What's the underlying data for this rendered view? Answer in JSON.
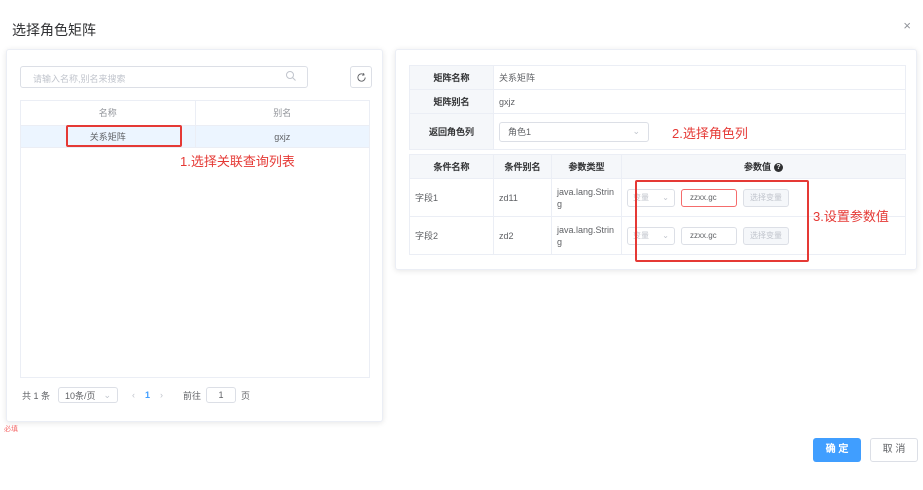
{
  "dialog": {
    "title": "选择角色矩阵",
    "close_icon": "×"
  },
  "left": {
    "search_placeholder": "请输入名称,别名来搜索",
    "table": {
      "headers": [
        "名称",
        "别名"
      ],
      "rows": [
        {
          "name": "关系矩阵",
          "alias": "gxjz"
        }
      ]
    },
    "pagination": {
      "total": "共 1 条",
      "page_size": "10条/页",
      "prev": "‹",
      "current": "1",
      "next": "›",
      "goto": "前往",
      "jump_value": "1",
      "page_suffix": "页"
    },
    "required_note": "必填"
  },
  "right": {
    "info": {
      "matrix_name_label": "矩阵名称",
      "matrix_name_value": "关系矩阵",
      "matrix_alias_label": "矩阵别名",
      "matrix_alias_value": "gxjz",
      "return_col_label": "返回角色列",
      "return_col_value": "角色1"
    },
    "cond_table": {
      "headers": [
        "条件名称",
        "条件别名",
        "参数类型",
        "参数值"
      ],
      "help_icon": "?",
      "rows": [
        {
          "name": "字段1",
          "alias": "zd11",
          "type": "java.lang.String",
          "var_select": "变量",
          "value": "zzxx.gc",
          "choose": "选择变量"
        },
        {
          "name": "字段2",
          "alias": "zd2",
          "type": "java.lang.String",
          "var_select": "变量",
          "value": "zzxx.gc",
          "choose": "选择变量"
        }
      ]
    }
  },
  "annotations": {
    "step1": "1.选择关联查询列表",
    "step2": "2.选择角色列",
    "step3": "3.设置参数值",
    "color": "#e53935"
  },
  "footer": {
    "ok": "确 定",
    "cancel": "取 消"
  },
  "colors": {
    "primary": "#409eff",
    "error": "#f56c6c"
  }
}
